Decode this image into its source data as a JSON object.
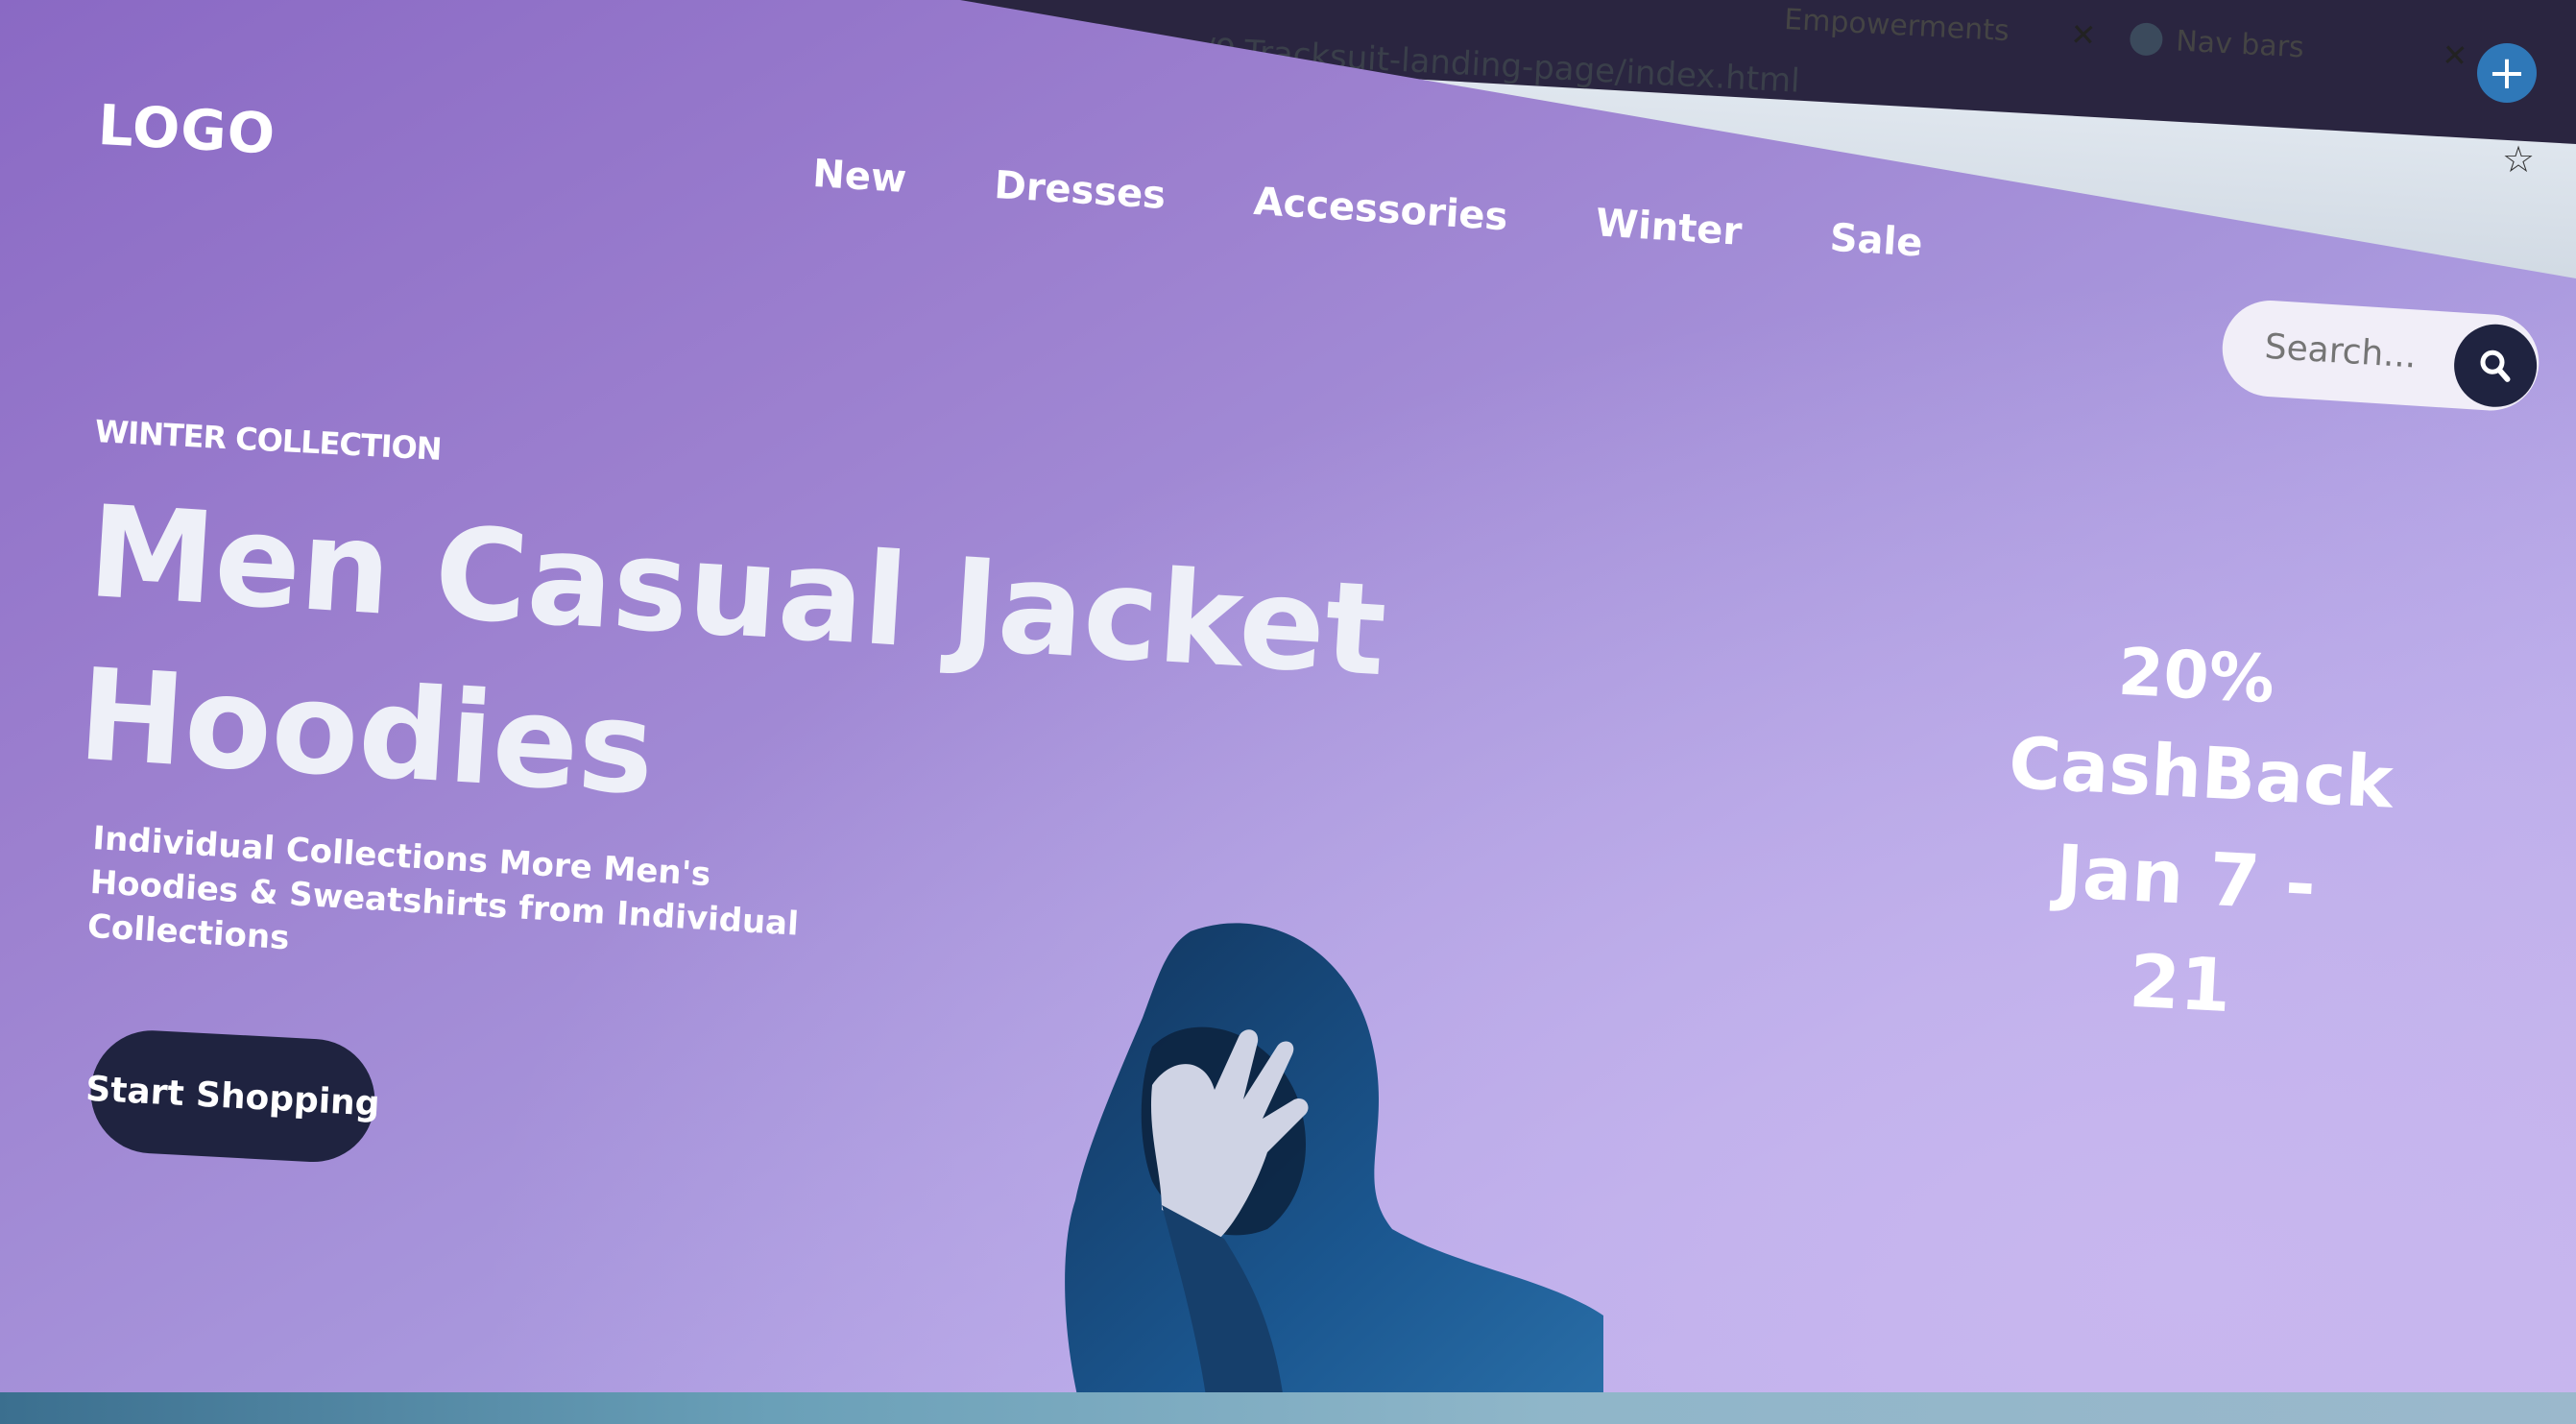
{
  "browser": {
    "url": "…/30days-css/9-Tracksuit-landing-page/index.html",
    "tabs": [
      {
        "label": "Empowerments"
      },
      {
        "label": "Nav bars"
      }
    ]
  },
  "header": {
    "logo": "LOGO",
    "nav": [
      "New",
      "Dresses",
      "Accessories",
      "Winter",
      "Sale"
    ],
    "search_placeholder": "Search..."
  },
  "hero": {
    "eyebrow": "WINTER COLLECTION",
    "title_line1": "Men Casual Jacket",
    "title_line2": "Hoodies",
    "description": "Individual Collections More Men's Hoodies & Sweatshirts from Individual Collections",
    "cta_label": "Start Shopping"
  },
  "promo": {
    "percent": "20%",
    "label": "CashBack",
    "dates": "Jan 7 - 21"
  },
  "colors": {
    "accent_dark": "#1f2340",
    "hero_purple": "#9c80cf",
    "hoodie_blue": "#1b4f8a"
  },
  "icons": {
    "search": "search-icon",
    "new_tab": "plus-icon",
    "bookmark": "star-icon",
    "close": "close-icon",
    "tab_favicon": "globe-icon"
  }
}
